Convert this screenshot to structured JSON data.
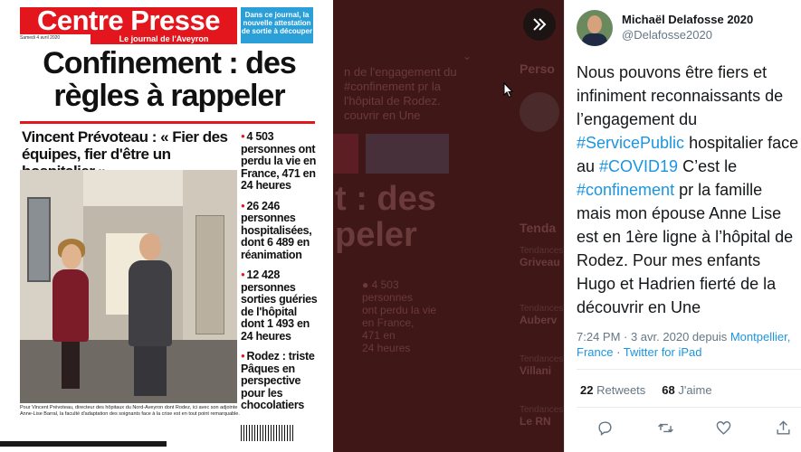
{
  "newspaper": {
    "masthead": "Centre Presse",
    "masthead_sub": "Le journal de l'Aveyron",
    "date_line": "Samedi 4 avril 2020",
    "promo": "Dans ce journal, la nouvelle attestation de sortie à découper",
    "headline": "Confinement : des règles à rappeler",
    "sub_headline": "Vincent Prévoteau : « Fier des équipes, fier d'être un hospitalier »",
    "stats": [
      {
        "num": "4 503",
        "text": "personnes ont perdu la vie en France, 471 en 24 heures"
      },
      {
        "num": "26 246",
        "text": "personnes hospitalisées, dont 6 489 en réanimation"
      },
      {
        "num": "12 428",
        "text": "personnes sorties guéries de l'hôpital dont 1 493 en 24 heures"
      },
      {
        "num": "Rodez : triste",
        "text": "Pâques en perspective pour les chocolatiers"
      }
    ],
    "caption": "Pour Vincent Prévoteau, directeur des hôpitaux du Nord-Aveyron dont Rodez, ici avec son adjointe Anne-Lise Barral, la faculté d'adaptation des soignants face à la crise est en tout point remarquable."
  },
  "background": {
    "personne_label": "Perso",
    "trends_label": "Tenda",
    "trends": [
      {
        "label": "Tendances",
        "name": "Griveau"
      },
      {
        "label": "Tendances",
        "name": "Auberv"
      },
      {
        "label": "Tendances",
        "name": "Villani"
      },
      {
        "label": "Tendances",
        "name": "Le RN"
      }
    ]
  },
  "tweet": {
    "display_name": "Michaël Delafosse 2020",
    "handle": "@Delafosse2020",
    "text_parts": {
      "p1": "Nous pouvons être fiers et infiniment reconnaissants de l’engagement du ",
      "tag1": "#ServicePublic",
      "p2": " hospitalier face au ",
      "tag2": "#COVID19",
      "p3": " C’est le ",
      "tag3": "#confinement",
      "p4": " pr la famille mais mon épouse Anne Lise est en 1ère ligne à l’hôpital de Rodez. Pour mes enfants Hugo et Hadrien fierté de la découvrir en Une"
    },
    "time": "7:24 PM · 3 avr. 2020 depuis ",
    "location": "Montpellier, France",
    "sep": " · ",
    "source": "Twitter for iPad",
    "retweets_count": "22",
    "retweets_label": "Retweets",
    "likes_count": "68",
    "likes_label": "J'aime"
  },
  "icons": {
    "expand": "double-chevron-right-icon",
    "reply": "reply-icon",
    "retweet": "retweet-icon",
    "like": "heart-icon",
    "share": "share-icon"
  },
  "colors": {
    "brand_red": "#e3161d",
    "twitter_blue": "#1b95e0",
    "overlay": "#3f1717"
  }
}
